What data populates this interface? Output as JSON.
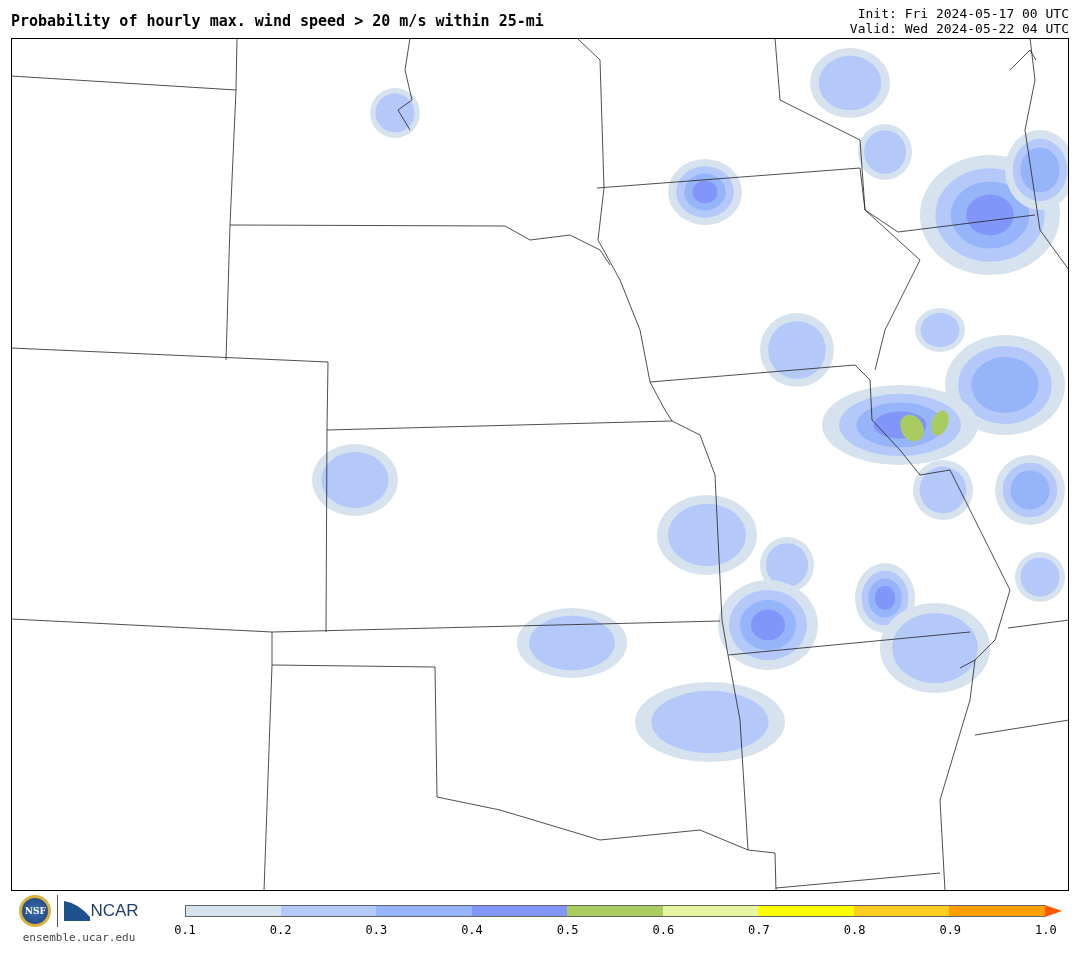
{
  "title": "Probability of hourly max. wind speed > 20 m/s within 25-mi",
  "init": "Init: Fri 2024-05-17 00 UTC",
  "valid": "Valid: Wed 2024-05-22 04 UTC",
  "logos": {
    "nsf": "NSF",
    "ncar": "NCAR",
    "site": "ensemble.ucar.edu"
  },
  "colorbar": {
    "segments": [
      {
        "color": "#d6e2ee"
      },
      {
        "color": "#b4c8fa"
      },
      {
        "color": "#96b4fa"
      },
      {
        "color": "#8296fa"
      },
      {
        "color": "#a8cc60"
      },
      {
        "color": "#e6f5a0"
      },
      {
        "color": "#ffff00"
      },
      {
        "color": "#ffcd1e"
      },
      {
        "color": "#ffa000"
      },
      {
        "kind": "arrow",
        "color": "#ff5a00"
      }
    ],
    "ticks": [
      "0.1",
      "0.2",
      "0.3",
      "0.4",
      "0.5",
      "0.6",
      "0.7",
      "0.8",
      "0.9",
      "1.0"
    ]
  }
}
